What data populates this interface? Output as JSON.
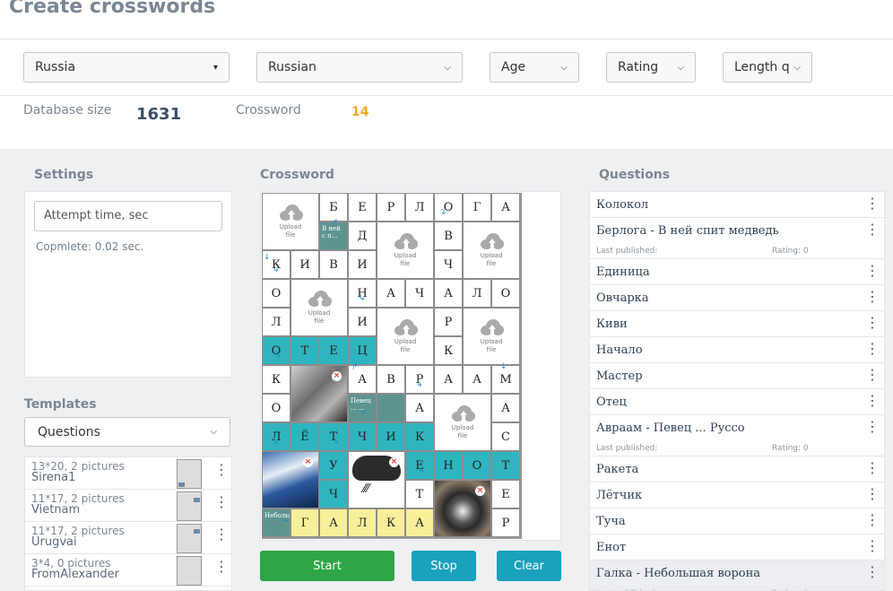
{
  "title": "Create crosswords",
  "filters": {
    "country": "Russia",
    "language": "Russian",
    "age": "Age",
    "rating": "Rating",
    "length": "Length q"
  },
  "stats": {
    "db_label": "Database size",
    "db_value": "1631",
    "cw_label": "Crossword",
    "cw_value": "14"
  },
  "settings": {
    "heading": "Settings",
    "attempt_placeholder": "Attempt time, sec",
    "complete": "Copmlete: 0.02 sec."
  },
  "templates": {
    "heading": "Templates",
    "select": "Questions",
    "items": [
      {
        "desc": "13*20, 2 pictures",
        "name": "Sirena1"
      },
      {
        "desc": "11*17, 2 pictures",
        "name": "Vietnam"
      },
      {
        "desc": "11*17, 2 pictures",
        "name": "Urugvai"
      },
      {
        "desc": "3*4, 0 pictures",
        "name": "FromAlexander"
      }
    ]
  },
  "crossword": {
    "heading": "Crossword",
    "upload_label": "Upload file",
    "clue_berloga": "В ней с п...",
    "clue_pevec": "Певец ... ...",
    "clue_galka": "Небольша...",
    "letters": {
      "r0": [
        "Б",
        "Е",
        "Р",
        "Л",
        "О",
        "Г",
        "А"
      ],
      "r1a": "Д",
      "r1b": "В",
      "r2": [
        "К",
        "И",
        "В",
        "И",
        "Ч"
      ],
      "r3": [
        "О",
        "Н",
        "А",
        "Ч",
        "А",
        "Л",
        "О"
      ],
      "r4": [
        "Л",
        "И",
        "Р"
      ],
      "r5": [
        "О",
        "Т",
        "Е",
        "Ц",
        "К"
      ],
      "r6": [
        "К",
        "А",
        "В",
        "Р",
        "А",
        "А",
        "М"
      ],
      "r7": [
        "О",
        "А",
        "А"
      ],
      "r8": [
        "Л",
        "Ё",
        "Т",
        "Ч",
        "И",
        "К",
        "С"
      ],
      "r9": [
        "У",
        "Е",
        "Н",
        "О",
        "Т"
      ],
      "r10": [
        "Ч",
        "Т",
        "Е"
      ],
      "r11": [
        "Г",
        "А",
        "Л",
        "К",
        "А",
        "Р"
      ]
    }
  },
  "buttons": {
    "start": "Start",
    "stop": "Stop",
    "clear": "Clear"
  },
  "questions": {
    "heading": "Questions",
    "items": [
      {
        "text": "Колокол"
      },
      {
        "text": "Берлога - В ней спит медведь",
        "last": "Last published:",
        "rating": "Rating: 0"
      },
      {
        "text": "Единица"
      },
      {
        "text": "Овчарка"
      },
      {
        "text": "Киви"
      },
      {
        "text": "Начало"
      },
      {
        "text": "Мастер"
      },
      {
        "text": "Отец"
      },
      {
        "text": "Авраам - Певец ... Руссо",
        "last": "Last published:",
        "rating": "Rating: 0"
      },
      {
        "text": "Ракета"
      },
      {
        "text": "Лётчик"
      },
      {
        "text": "Туча"
      },
      {
        "text": "Енот"
      },
      {
        "text": "Галка - Небольшая ворона",
        "last": "Last published:",
        "rating": "Rating: 0",
        "selected": true
      }
    ]
  },
  "colors": {
    "start": "#2fa548",
    "stop": "#1aa1bd",
    "clear": "#1aa1bd",
    "accent": "#f5a623",
    "teal": "#2fb5bf",
    "yellow": "#f7ef9a"
  }
}
